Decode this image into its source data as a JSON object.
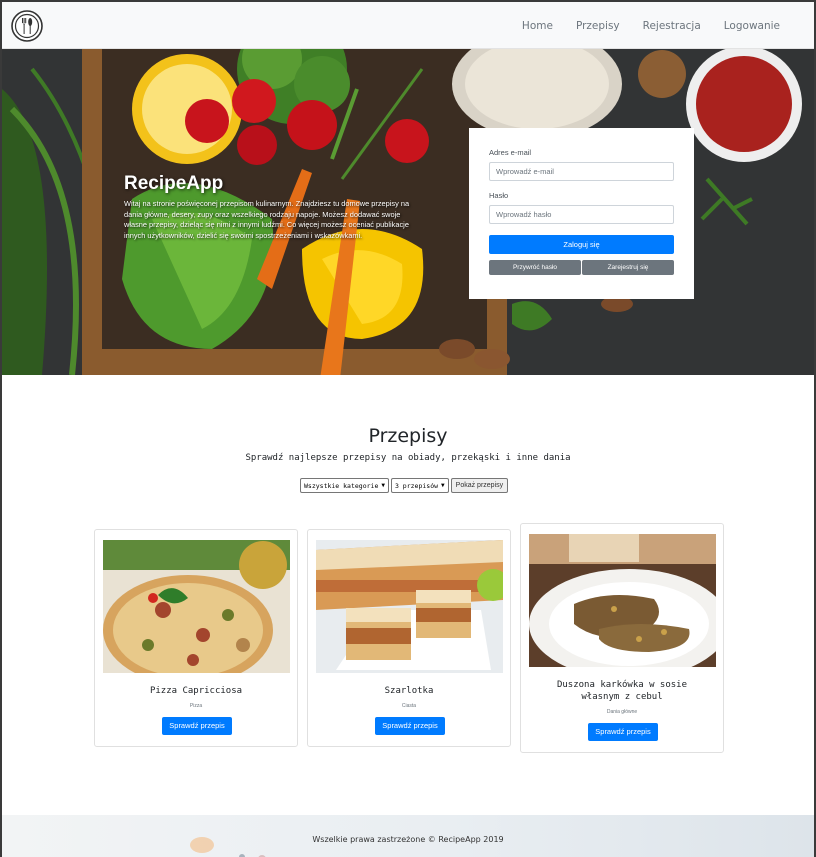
{
  "nav": {
    "items": [
      "Home",
      "Przepisy",
      "Rejestracja",
      "Logowanie"
    ]
  },
  "hero": {
    "title": "RecipeApp",
    "text": "Witaj na stronie poświęconej przepisom kulinarnym. Znajdziesz tu domowe przepisy na dania główne, desery, zupy oraz wszelkiego rodzaju napoje. Możesz dodawać swoje własne przepisy, dzieląc się nimi z innymi ludźmi. Co więcej możesz oceniać publikacje innych użytkowników, dzielić się swoimi spostrzeżeniami i wskazówkami."
  },
  "login": {
    "email_label": "Adres e-mail",
    "email_placeholder": "Wprowadź e-mail",
    "password_label": "Hasło",
    "password_placeholder": "Wprowadź hasło",
    "login_button": "Zaloguj się",
    "recover_button": "Przywróć hasło",
    "register_button": "Zarejestruj się"
  },
  "recipes": {
    "title": "Przepisy",
    "subtitle": "Sprawdź najlepsze przepisy na obiady, przekąski i inne dania",
    "category_select": "Wszystkie kategorie",
    "count_select": "3 przepisów",
    "show_button": "Pokaż przepisy",
    "cards": [
      {
        "title": "Pizza Capricciosa",
        "category": "Pizza",
        "button": "Sprawdź przepis"
      },
      {
        "title": "Szarlotka",
        "category": "Ciasta",
        "button": "Sprawdź przepis"
      },
      {
        "title": "Duszona karkówka w sosie własnym z cebul",
        "category": "Dania główne",
        "button": "Sprawdź przepis"
      }
    ]
  },
  "footer": {
    "text": "Wszelkie prawa zastrzeżone © RecipeApp 2019"
  },
  "colors": {
    "primary": "#007bff",
    "secondary": "#6c757d",
    "navbar": "#f8f9fa"
  }
}
